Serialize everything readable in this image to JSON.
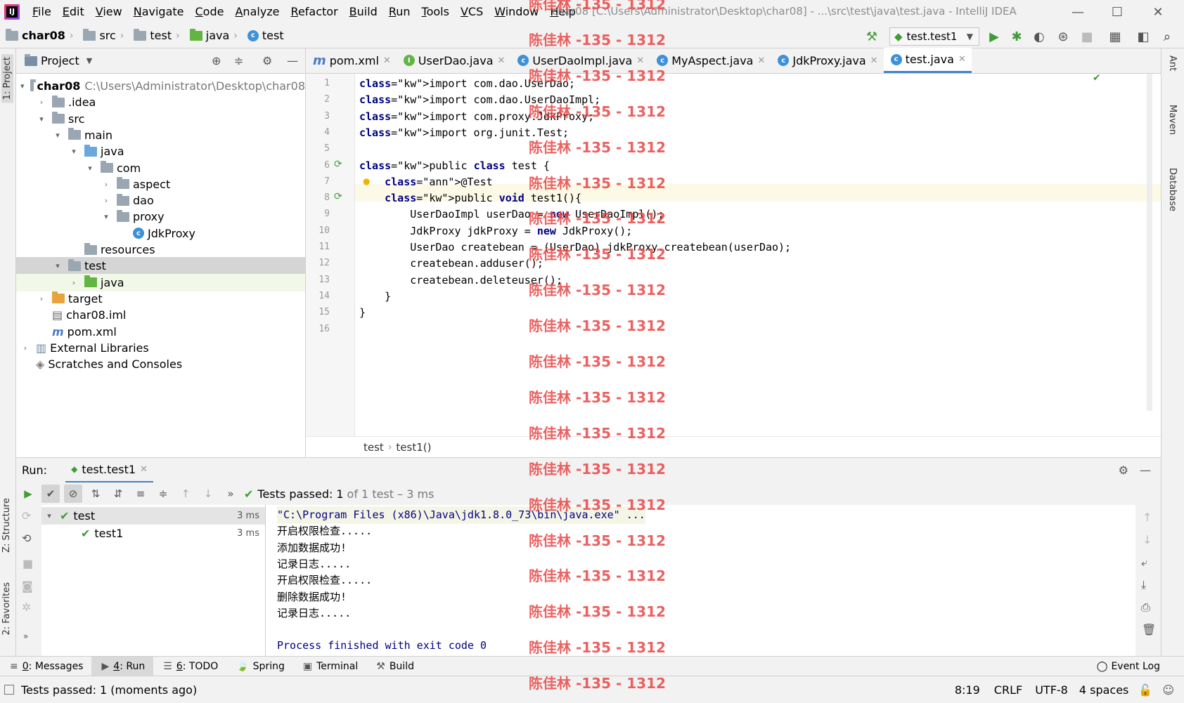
{
  "app": {
    "logo_text": "IJ",
    "title": "char08 [C:\\Users\\Administrator\\Desktop\\char08] - ...\\src\\test\\java\\test.java - IntelliJ IDEA"
  },
  "menu": [
    "File",
    "Edit",
    "View",
    "Navigate",
    "Code",
    "Analyze",
    "Refactor",
    "Build",
    "Run",
    "Tools",
    "VCS",
    "Window",
    "Help"
  ],
  "navbar": {
    "crumbs": [
      "char08",
      "src",
      "test",
      "java",
      "test"
    ],
    "run_config": "test.test1"
  },
  "project_panel": {
    "title": "Project",
    "tree": [
      {
        "label": "char08",
        "extra": "C:\\Users\\Administrator\\Desktop\\char08",
        "depth": 0,
        "arrow": "down",
        "icon": "folder"
      },
      {
        "label": ".idea",
        "depth": 1,
        "arrow": "right",
        "icon": "folder"
      },
      {
        "label": "src",
        "depth": 1,
        "arrow": "down",
        "icon": "folder"
      },
      {
        "label": "main",
        "depth": 2,
        "arrow": "down",
        "icon": "folder"
      },
      {
        "label": "java",
        "depth": 3,
        "arrow": "down",
        "icon": "folder-blue"
      },
      {
        "label": "com",
        "depth": 4,
        "arrow": "down",
        "icon": "folder"
      },
      {
        "label": "aspect",
        "depth": 5,
        "arrow": "right",
        "icon": "folder"
      },
      {
        "label": "dao",
        "depth": 5,
        "arrow": "right",
        "icon": "folder"
      },
      {
        "label": "proxy",
        "depth": 5,
        "arrow": "down",
        "icon": "folder"
      },
      {
        "label": "JdkProxy",
        "depth": 6,
        "arrow": "",
        "icon": "class"
      },
      {
        "label": "resources",
        "depth": 3,
        "arrow": "",
        "icon": "folder"
      },
      {
        "label": "test",
        "depth": 2,
        "arrow": "down",
        "icon": "folder"
      },
      {
        "label": "java",
        "depth": 3,
        "arrow": "right",
        "icon": "folder-green"
      },
      {
        "label": "target",
        "depth": 1,
        "arrow": "right",
        "icon": "folder-orange"
      },
      {
        "label": "char08.iml",
        "depth": 1,
        "arrow": "",
        "icon": "file"
      },
      {
        "label": "pom.xml",
        "depth": 1,
        "arrow": "",
        "icon": "maven"
      },
      {
        "label": "External Libraries",
        "depth": 0,
        "arrow": "right",
        "icon": "lib"
      },
      {
        "label": "Scratches and Consoles",
        "depth": 0,
        "arrow": "",
        "icon": "scratch"
      }
    ]
  },
  "editor_tabs": [
    {
      "label": "pom.xml",
      "icon": "m"
    },
    {
      "label": "UserDao.java",
      "icon": "I"
    },
    {
      "label": "UserDaoImpl.java",
      "icon": "C"
    },
    {
      "label": "MyAspect.java",
      "icon": "C"
    },
    {
      "label": "JdkProxy.java",
      "icon": "C"
    },
    {
      "label": "test.java",
      "icon": "C"
    }
  ],
  "code_lines": [
    "import com.dao.UserDao;",
    "import com.dao.UserDaoImpl;",
    "import com.proxy.JdkProxy;",
    "import org.junit.Test;",
    "",
    "public class test {",
    "    @Test",
    "    public void test1(){",
    "        UserDaoImpl userDao = new UserDaoImpl();",
    "        JdkProxy jdkProxy = new JdkProxy();",
    "        UserDao createbean = (UserDao) jdkProxy.createbean(userDao);",
    "        createbean.adduser();",
    "        createbean.deleteuser();",
    "    }",
    "}",
    ""
  ],
  "line_numbers": [
    "1",
    "2",
    "3",
    "4",
    "5",
    "6",
    "7",
    "8",
    "9",
    "10",
    "11",
    "12",
    "13",
    "14",
    "15",
    "16"
  ],
  "editor_breadcrumb": [
    "test",
    "test1()"
  ],
  "run_panel": {
    "label": "Run:",
    "tab": "test.test1",
    "status_prefix": "Tests passed:",
    "status_count": "1",
    "status_rest": "of 1 test – 3 ms",
    "tree": [
      {
        "label": "test",
        "time": "3 ms"
      },
      {
        "label": "test1",
        "time": "3 ms"
      }
    ],
    "console": [
      "\"C:\\Program Files (x86)\\Java\\jdk1.8.0_73\\bin\\java.exe\" ...",
      "开启权限检查.....",
      "添加数据成功!",
      "记录日志.....",
      "开启权限检查.....",
      "删除数据成功!",
      "记录日志.....",
      "",
      "Process finished with exit code 0"
    ]
  },
  "bottom_tabs": [
    {
      "num": "0",
      "label": ": Messages"
    },
    {
      "num": "4",
      "label": ": Run"
    },
    {
      "num": "6",
      "label": ": TODO"
    },
    {
      "num": "",
      "label": "Spring"
    },
    {
      "num": "",
      "label": "Terminal"
    },
    {
      "num": "",
      "label": "Build"
    }
  ],
  "event_log": "Event Log",
  "status_bar": {
    "message": "Tests passed: 1 (moments ago)",
    "position": "8:19",
    "line_sep": "CRLF",
    "encoding": "UTF-8",
    "indent": "4 spaces"
  },
  "side_tabs": {
    "left_top": "1: Project",
    "left_structure": "Z: Structure",
    "left_fav": "2: Favorites",
    "right": [
      "Ant",
      "Maven",
      "Database"
    ]
  },
  "watermark": "陈佳林 -135 - 1312"
}
